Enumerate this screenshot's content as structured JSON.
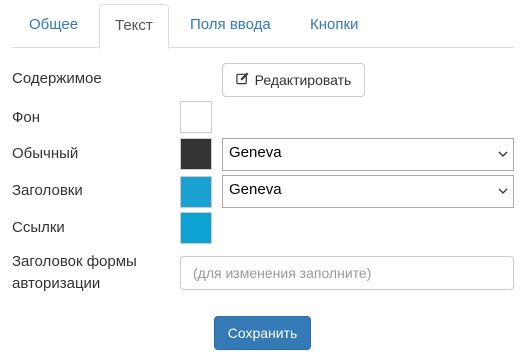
{
  "tabs": [
    {
      "label": "Общее"
    },
    {
      "label": "Текст"
    },
    {
      "label": "Поля ввода"
    },
    {
      "label": "Кнопки"
    }
  ],
  "active_tab": "Текст",
  "content": {
    "label": "Содержимое",
    "edit_button": "Редактировать",
    "edit_icon": "edit-icon"
  },
  "background": {
    "label": "Фон",
    "color": "#ffffff"
  },
  "normal": {
    "label": "Обычный",
    "color": "#333333",
    "font": "Geneva"
  },
  "headings": {
    "label": "Заголовки",
    "color": "#1ba1d1",
    "font": "Geneva"
  },
  "links": {
    "label": "Ссылки",
    "color": "#0ea2d3"
  },
  "auth_form_title": {
    "label": "Заголовок формы авторизации",
    "placeholder": "(для изменения заполните)",
    "value": ""
  },
  "save_button": "Сохранить"
}
